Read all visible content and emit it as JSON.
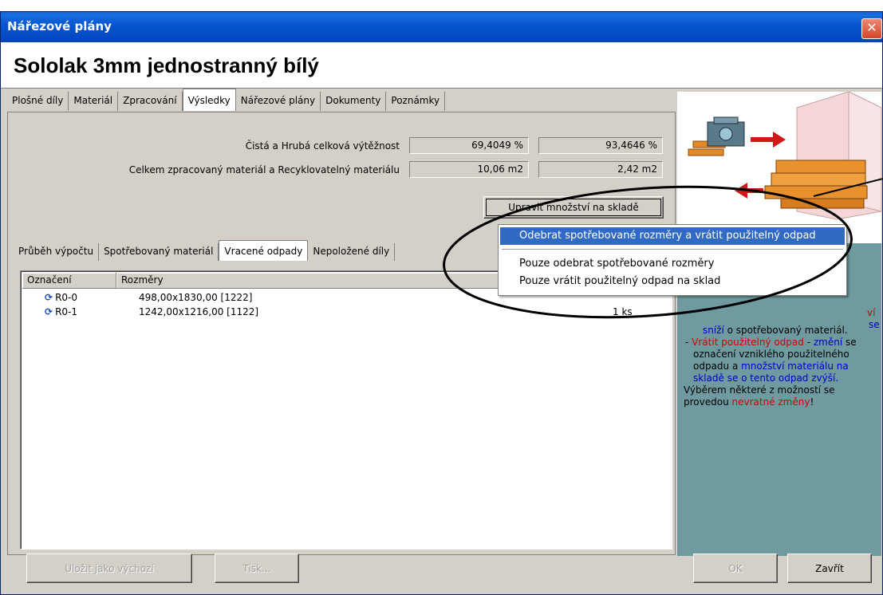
{
  "window": {
    "title": "Nářezové plány",
    "close_glyph": "✕"
  },
  "heading": "Sololak 3mm jednostranný bílý",
  "main_tabs": [
    "Plošné díly",
    "Materiál",
    "Zpracování",
    "Výsledky",
    "Nářezové plány",
    "Dokumenty",
    "Poznámky"
  ],
  "results": {
    "yield_label": "Čistá a Hrubá celková výtěžnost",
    "net_yield": "69,4049 %",
    "gross_yield": "93,4646 %",
    "material_label": "Celkem zpracovaný materiál a Recyklovatelný materiálu",
    "processed_material": "10,06 m2",
    "recyclable_material": "2,42 m2",
    "adjust_button": "Upravit množství na skladě"
  },
  "sub_tabs": [
    "Průběh výpočtu",
    "Spotřebovaný materiál",
    "Vracené odpady",
    "Nepoložené díly"
  ],
  "list": {
    "col_label": "Označení",
    "col_dims": "Rozměry",
    "rows": [
      {
        "label": "R0-0",
        "dims": "498,00x1830,00  [1222]",
        "qty": ""
      },
      {
        "label": "R0-1",
        "dims": "1242,00x1216,00  [1122]",
        "qty": "1 ks"
      }
    ]
  },
  "menu": [
    "Odebrat spotřebované rozměry a vrátit použitelný odpad",
    "Pouze odebrat spotřebované rozměry",
    "Pouze vrátit použitelný odpad na sklad"
  ],
  "help": {
    "frag_a": "ví",
    "frag_b": "se",
    "line1_blue": "sníží",
    "line1_rest": " o spotřebovaný materiál.",
    "item2_red": "Vrátit použitelný odpad",
    "item2_sep": " - ",
    "item2_blue": "změní",
    "item2_black": "se označení vzniklého použitelného odpadu a",
    "item2_blue2": "množství materiálu na skladě se o tento odpad zvýší.",
    "warn_pre": "Výběrem některé z možností se provedou ",
    "warn_red": "nevratné změny",
    "warn_post": "!"
  },
  "footer": {
    "save_default": "Uložit jako výchozí",
    "print": "Tisk...",
    "ok": "OK",
    "close": "Zavřít"
  },
  "colors": {
    "title_bar": "#0554d0",
    "menu_highlight": "#316ac5",
    "side_panel": "#6e9aa0"
  }
}
